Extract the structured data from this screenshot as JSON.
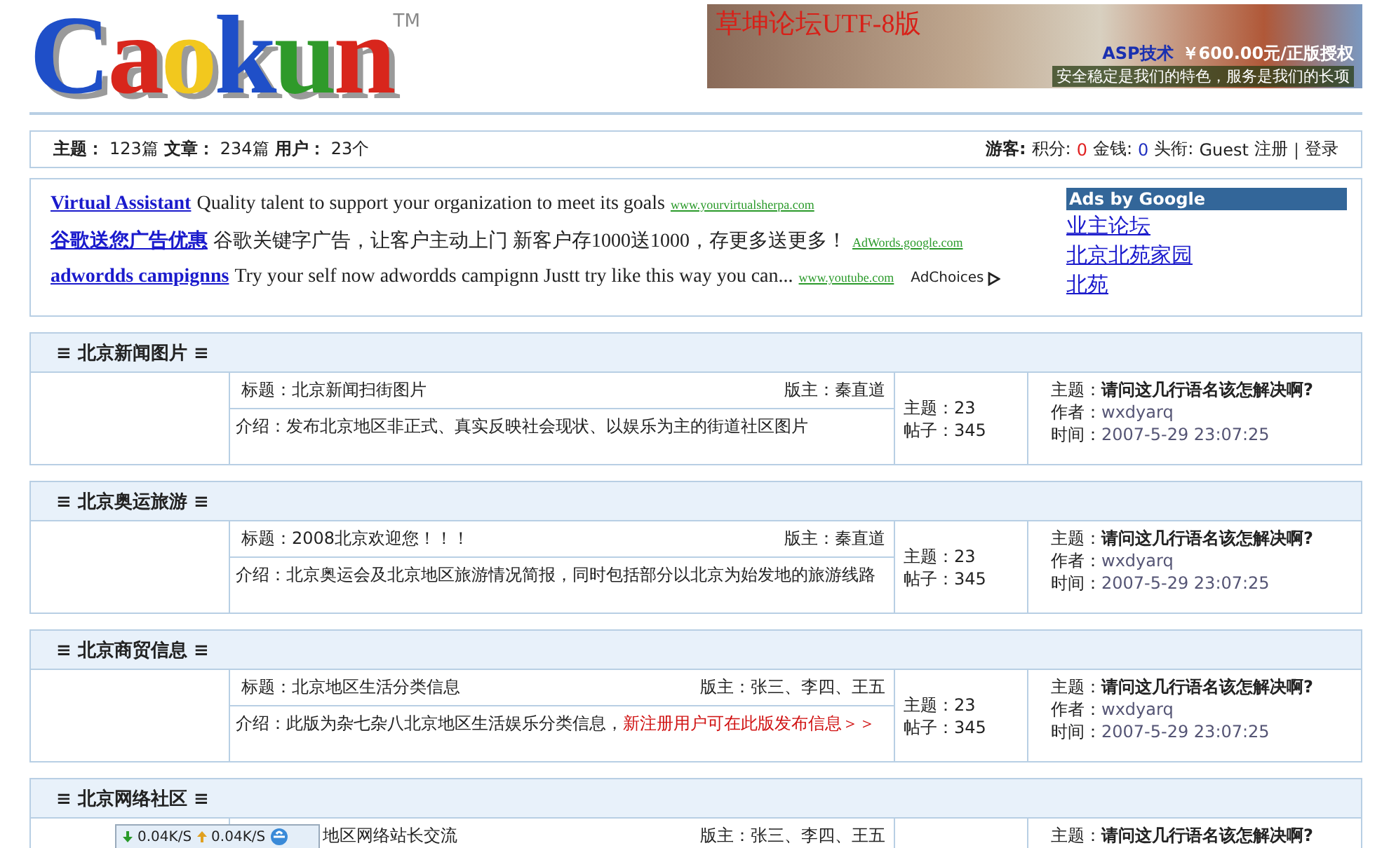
{
  "logo": {
    "letters": [
      {
        "char": "C",
        "color": "#1f4fc8"
      },
      {
        "char": "a",
        "color": "#d8261c"
      },
      {
        "char": "o",
        "color": "#f2c81e"
      },
      {
        "char": "k",
        "color": "#1f4fc8"
      },
      {
        "char": "u",
        "color": "#2f9a2a"
      },
      {
        "char": "n",
        "color": "#d8261c"
      }
    ],
    "mark": "TM"
  },
  "banner": {
    "title": "草坤论坛UTF-8版",
    "tag": "ASP技术",
    "price": "￥600.00元/正版授权",
    "slogan": "安全稳定是我们的特色，服务是我们的长项"
  },
  "stats": [
    {
      "label": "主题：",
      "value": "123篇"
    },
    {
      "label": "文章：",
      "value": "234篇"
    },
    {
      "label": "用户：",
      "value": "23个"
    }
  ],
  "user": {
    "role": "游客:",
    "fields": [
      {
        "label": "积分:",
        "value": "0",
        "color": "#e02020"
      },
      {
        "label": "金钱:",
        "value": "0",
        "color": "#2030c0"
      },
      {
        "label": "头衔:",
        "value": "Guest",
        "color": "#222222"
      }
    ],
    "links": [
      "注册",
      "登录"
    ],
    "separator": "|"
  },
  "ads": {
    "rows": [
      {
        "title": "Virtual Assistant",
        "text": "Quality talent to support your organization to meet its goals",
        "url": "www.yourvirtualsherpa.com"
      },
      {
        "title": "谷歌送您广告优惠",
        "text": "谷歌关键字广告，让客户主动上门 新客户存1000送1000，存更多送更多！",
        "url": "AdWords.google.com"
      },
      {
        "title": "adwordds campignns",
        "text": "Try your self now adwordds campignn Justt try like this way you can...",
        "url": "www.youtube.com"
      }
    ],
    "choices": "AdChoices",
    "side_title": "Ads by Google",
    "side_links": [
      "业主论坛",
      "北京北苑家园",
      "北苑"
    ]
  },
  "forums": [
    {
      "title": "≡ 北京新闻图片 ≡",
      "topic": "标题：北京新闻扫街图片",
      "covered": false,
      "moderator": "版主：秦直道",
      "intro": "介绍：发布北京地区非正式、真实反映社会现状、以娱乐为主的街道社区图片",
      "topics": "主题：23",
      "posts": "帖子：345",
      "last": [
        {
          "label": "主题：",
          "value": "请问这几行语名该怎解决啊?",
          "kind": "subject"
        },
        {
          "label": "作者：",
          "value": "wxdyarq",
          "kind": "meta"
        },
        {
          "label": "时间：",
          "value": "2007-5-29 23:07:25",
          "kind": "meta"
        }
      ]
    },
    {
      "title": "≡ 北京奥运旅游 ≡",
      "topic": "标题：2008北京欢迎您！！！",
      "covered": false,
      "moderator": "版主：秦直道",
      "intro": "介绍：北京奥运会及北京地区旅游情况简报，同时包括部分以北京为始发地的旅游线路",
      "topics": "主题：23",
      "posts": "帖子：345",
      "last": [
        {
          "label": "主题：",
          "value": "请问这几行语名该怎解决啊?",
          "kind": "subject"
        },
        {
          "label": "作者：",
          "value": "wxdyarq",
          "kind": "meta"
        },
        {
          "label": "时间：",
          "value": "2007-5-29 23:07:25",
          "kind": "meta"
        }
      ]
    },
    {
      "title": "≡ 北京商贸信息 ≡",
      "topic": "标题：北京地区生活分类信息",
      "covered": false,
      "moderator": "版主：张三、李四、王五",
      "intro": "介绍：此版为杂七杂八北京地区生活娱乐分类信息，",
      "notice": "新注册用户可在此版发布信息＞＞",
      "topics": "主题：23",
      "posts": "帖子：345",
      "last": [
        {
          "label": "主题：",
          "value": "请问这几行语名该怎解决啊?",
          "kind": "subject"
        },
        {
          "label": "作者：",
          "value": "wxdyarq",
          "kind": "meta"
        },
        {
          "label": "时间：",
          "value": "2007-5-29 23:07:25",
          "kind": "meta"
        }
      ]
    },
    {
      "title": "≡ 北京网络社区 ≡",
      "topic": "地区网络站长交流",
      "covered": true,
      "moderator": "版主：张三、李四、王五",
      "last": [
        {
          "label": "主题：",
          "value": "请问这几行语名该怎解决啊?",
          "kind": "subject"
        }
      ]
    }
  ],
  "net_speed": {
    "down": "0.04K/S",
    "up": "0.04K/S"
  }
}
